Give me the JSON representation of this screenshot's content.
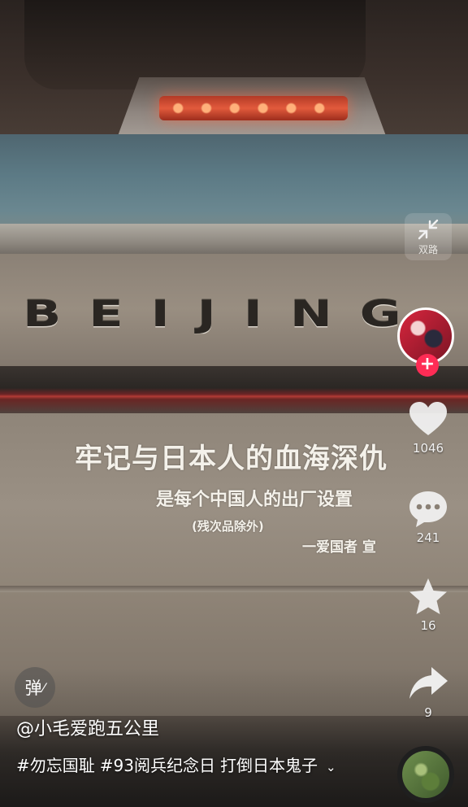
{
  "video": {
    "decal_main": "牢记与日本人的血海深仇",
    "decal_sub": "是每个中国人的出厂设置",
    "decal_note": "(残次品除外)",
    "decal_sign": "一爱国者 宣",
    "brand_text": "BEIJING"
  },
  "overlay": {
    "pip_label": "双路",
    "danmu_label": "弹",
    "like_count": "1046",
    "comment_count": "241",
    "favorite_count": "16",
    "share_count": "9",
    "follow_plus": "+"
  },
  "post": {
    "author": "@小毛爱跑五公里",
    "tags": [
      "#勿忘国耻",
      "#93阅兵纪念日",
      "打倒日本鬼子"
    ]
  },
  "colors": {
    "follow_accent": "#fe2c55"
  }
}
